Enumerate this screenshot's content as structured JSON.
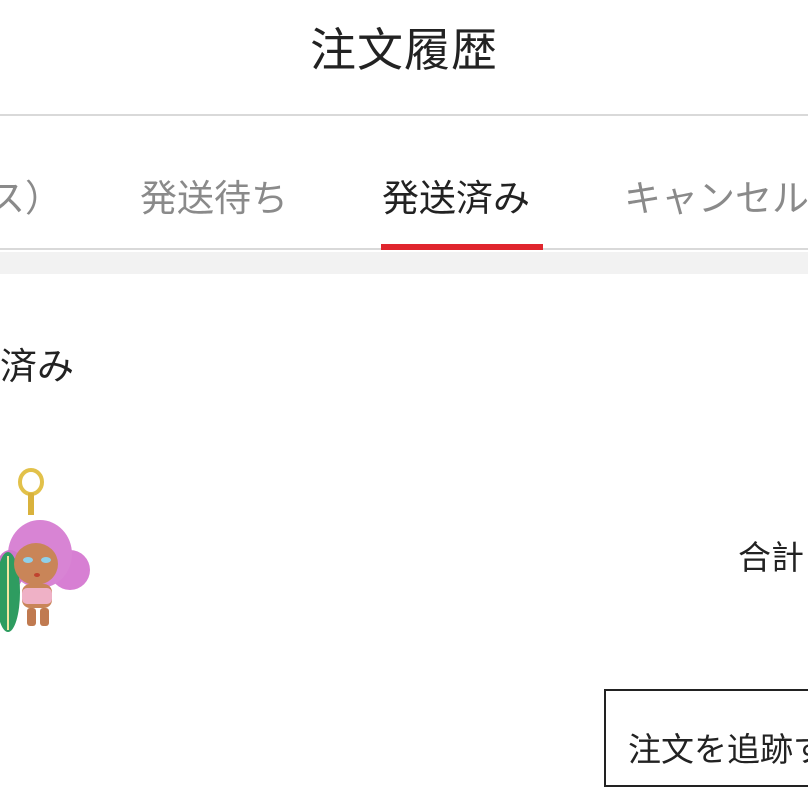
{
  "header": {
    "title": "注文履歴"
  },
  "tabs": [
    {
      "label": "ス）"
    },
    {
      "label": "発送待ち"
    },
    {
      "label": "発送済み"
    },
    {
      "label": "キャンセル"
    }
  ],
  "colors": {
    "active_indicator": "#e0262e",
    "inactive_tab": "#8a8a8a"
  },
  "order": {
    "status": "済み",
    "total_label": "合計",
    "track_button_label": "注文を追跡す"
  }
}
